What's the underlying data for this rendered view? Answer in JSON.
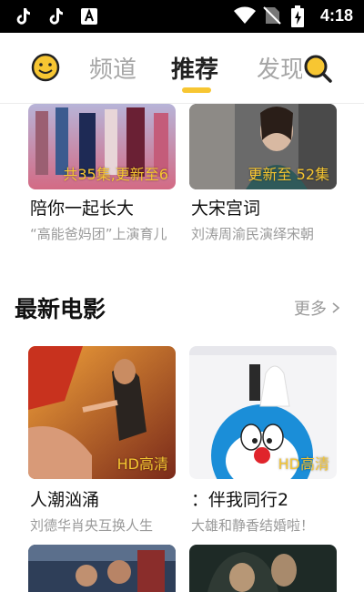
{
  "status_bar": {
    "time": "4:18",
    "icons": [
      "tiktok-icon",
      "tiktok-icon",
      "text-a-icon",
      "wifi-icon",
      "no-sim-icon",
      "battery-charging-icon"
    ]
  },
  "nav": {
    "tabs": [
      {
        "label": "频道"
      },
      {
        "label": "推荐"
      },
      {
        "label": "发现"
      }
    ],
    "active_tab": "推荐",
    "accent_color": "#f7c632"
  },
  "top_cards": [
    {
      "badge": "共35集,更新至6",
      "title": "陪你一起长大",
      "subtitle": "“高能爸妈团”上演育儿"
    },
    {
      "badge": "更新至 52集",
      "title": "大宋宫词",
      "subtitle": "刘涛周渝民演绎宋朝"
    }
  ],
  "section": {
    "title": "最新电影",
    "more_label": "更多"
  },
  "movie_cards": [
    {
      "badge": "HD高清",
      "title": "人潮汹涌",
      "subtitle": "刘德华肖央互换人生"
    },
    {
      "badge": "HD高清",
      "title": "：伴我同行2",
      "subtitle": "大雄和静香结婚啦！"
    }
  ]
}
